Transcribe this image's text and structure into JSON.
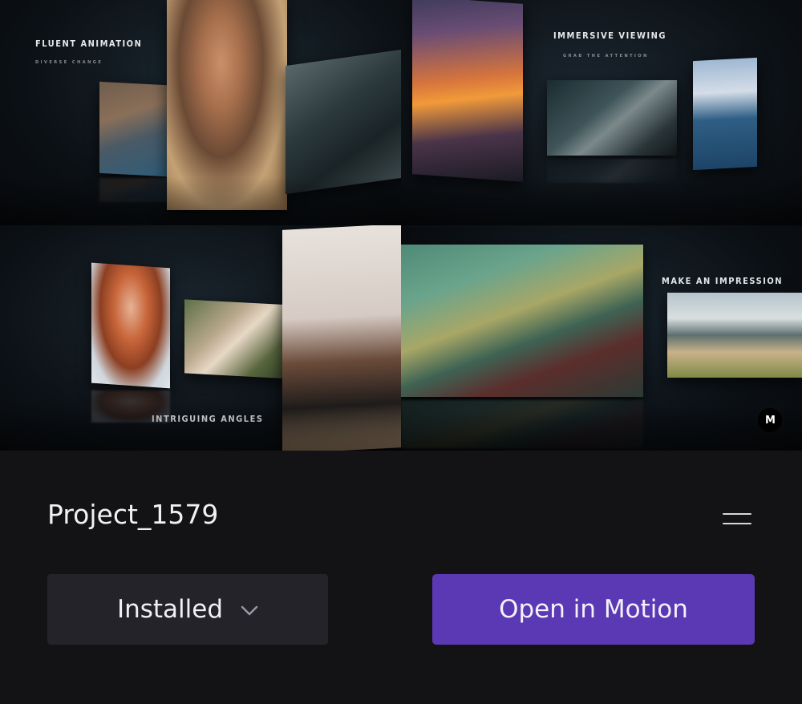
{
  "preview": {
    "headings": {
      "fluent": "FLUENT ANIMATION",
      "fluent_sub": "DIVERSE CHANGE",
      "immersive": "IMMERSIVE VIEWING",
      "immersive_sub": "GRAB THE ATTENTION",
      "intriguing": "INTRIGUING ANGLES",
      "impression": "MAKE AN IMPRESSION"
    },
    "brand_mark": "M"
  },
  "project": {
    "title": "Project_1579"
  },
  "status": {
    "selected": "Installed"
  },
  "actions": {
    "open_label": "Open in Motion"
  },
  "colors": {
    "background": "#131316",
    "dropdown": "#232329",
    "accent": "#5b38b4"
  },
  "icons": {
    "menu": "hamburger-icon",
    "dropdown": "chevron-down-icon",
    "brand": "motion-logo-icon"
  }
}
